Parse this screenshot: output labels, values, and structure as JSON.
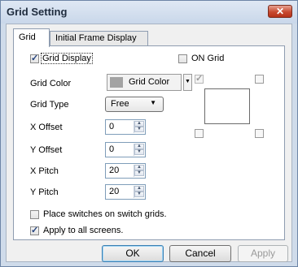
{
  "window": {
    "title": "Grid Setting",
    "close_label": "x"
  },
  "tabs": [
    {
      "label": "Grid",
      "active": true
    },
    {
      "label": "Initial Frame Display",
      "active": false
    }
  ],
  "grid_display": {
    "label": "Grid Display",
    "checked": true
  },
  "on_grid": {
    "label": "ON Grid",
    "checked": false
  },
  "grid_color": {
    "label": "Grid Color",
    "button_label": "Grid Color",
    "swatch": "#a3a3a3"
  },
  "grid_type": {
    "label": "Grid Type",
    "value": "Free"
  },
  "x_offset": {
    "label": "X Offset",
    "value": "0"
  },
  "y_offset": {
    "label": "Y Offset",
    "value": "0"
  },
  "x_pitch": {
    "label": "X Pitch",
    "value": "20"
  },
  "y_pitch": {
    "label": "Y Pitch",
    "value": "20"
  },
  "place_switches": {
    "label": "Place switches on switch grids.",
    "checked": false
  },
  "apply_all": {
    "label": "Apply to all screens.",
    "checked": true
  },
  "buttons": {
    "ok": "OK",
    "cancel": "Cancel",
    "apply": "Apply"
  }
}
